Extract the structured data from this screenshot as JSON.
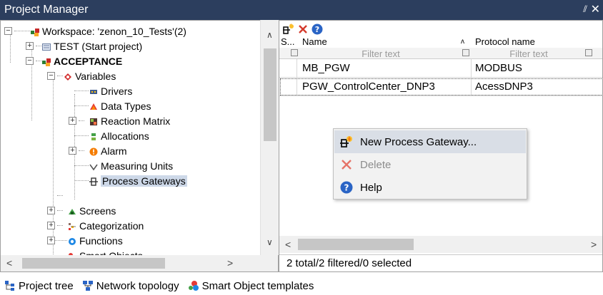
{
  "window": {
    "title": "Project Manager",
    "pin_glyph": "⫽",
    "close_glyph": "✕"
  },
  "tree": {
    "rows": [
      {
        "label": "Workspace: 'zenon_10_Tests'(2)",
        "expander": "−",
        "icon": "workspace-icon"
      },
      {
        "label": "TEST (Start project)",
        "expander": "+",
        "icon": "project-icon"
      },
      {
        "label": "ACCEPTANCE",
        "expander": "−",
        "icon": "project-active-icon"
      },
      {
        "label": "Variables",
        "expander": "−",
        "icon": "variables-icon"
      },
      {
        "label": "Drivers",
        "expander": "",
        "icon": "drivers-icon"
      },
      {
        "label": "Data Types",
        "expander": "",
        "icon": "data-types-icon"
      },
      {
        "label": "Reaction Matrix",
        "expander": "+",
        "icon": "reaction-matrix-icon"
      },
      {
        "label": "Allocations",
        "expander": "",
        "icon": "allocations-icon"
      },
      {
        "label": "Alarm",
        "expander": "+",
        "icon": "alarm-icon"
      },
      {
        "label": "Measuring Units",
        "expander": "",
        "icon": "measuring-units-icon"
      },
      {
        "label": "Process Gateways",
        "expander": "",
        "icon": "process-gateways-icon"
      },
      {
        "label": "Screens",
        "expander": "+",
        "icon": "screens-icon"
      },
      {
        "label": "Categorization",
        "expander": "+",
        "icon": "categorization-icon"
      },
      {
        "label": "Functions",
        "expander": "+",
        "icon": "functions-icon"
      },
      {
        "label": "Smart Objects",
        "expander": "",
        "icon": "smart-objects-icon"
      }
    ],
    "scroll_up": "∧",
    "scroll_down": "∨",
    "scroll_left": "<",
    "scroll_right": ">"
  },
  "grid": {
    "columns": [
      {
        "label": "S..."
      },
      {
        "label": "Name",
        "sort": "ᴧ"
      },
      {
        "label": "Protocol name"
      }
    ],
    "filter_placeholder": "Filter text",
    "rows": [
      {
        "name": "MB_PGW",
        "protocol": "MODBUS"
      },
      {
        "name": "PGW_ControlCenter_DNP3",
        "protocol": "AcessDNP3"
      }
    ],
    "status": "2 total/2 filtered/0 selected",
    "scroll_left": "<",
    "scroll_right": ">"
  },
  "context_menu": {
    "items": [
      {
        "label": "New Process Gateway...",
        "icon": "new-gateway-icon",
        "enabled": true
      },
      {
        "label": "Delete",
        "icon": "delete-icon",
        "enabled": false
      },
      {
        "label": "Help",
        "icon": "help-icon",
        "enabled": true
      }
    ]
  },
  "tabs": [
    {
      "label": "Project tree",
      "icon": "project-tree-icon"
    },
    {
      "label": "Network topology",
      "icon": "network-topology-icon"
    },
    {
      "label": "Smart Object templates",
      "icon": "smart-object-templates-icon"
    }
  ],
  "colors": {
    "titlebar": "#2c3e5e",
    "selection": "#cdd8e8",
    "menu_highlight": "#d9dee6",
    "delete_red": "#d33a2c",
    "help_blue": "#2a64c5"
  }
}
